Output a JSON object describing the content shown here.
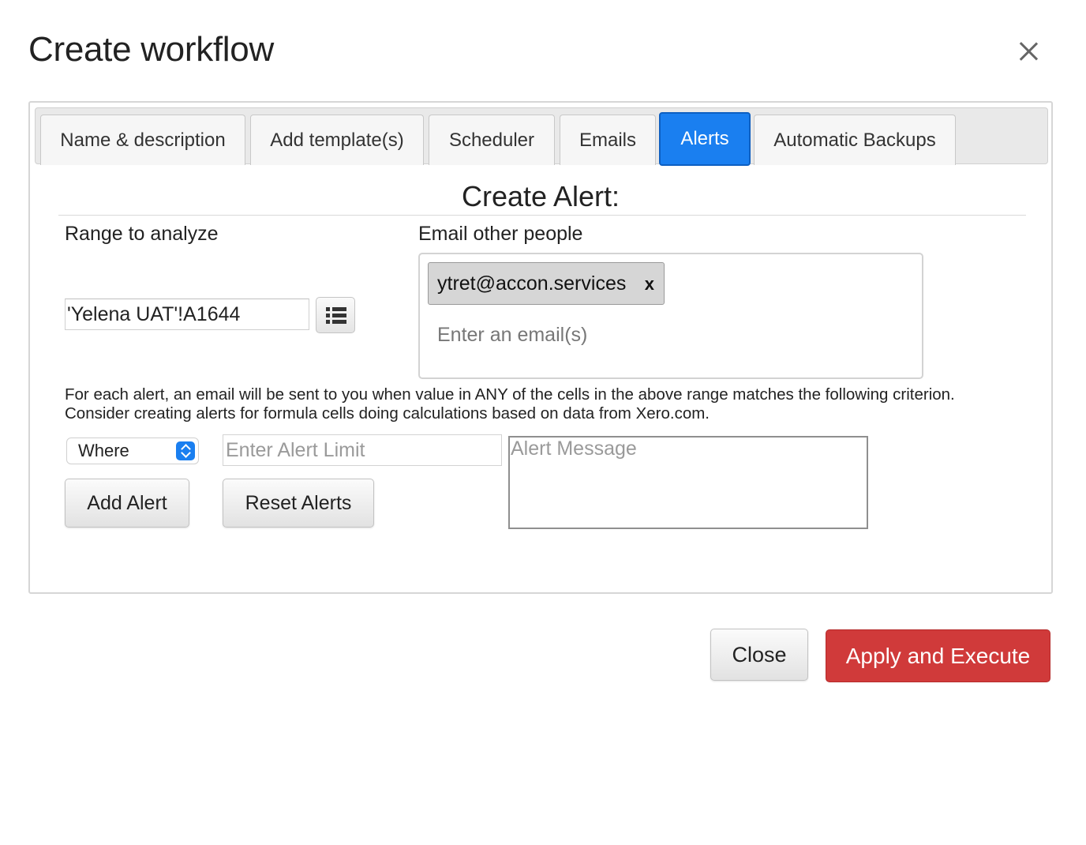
{
  "dialog": {
    "title": "Create workflow",
    "close_icon": "close-icon"
  },
  "tabs": [
    {
      "label": "Name & description",
      "active": false
    },
    {
      "label": "Add template(s)",
      "active": false
    },
    {
      "label": "Scheduler",
      "active": false
    },
    {
      "label": "Emails",
      "active": false
    },
    {
      "label": "Alerts",
      "active": true
    },
    {
      "label": "Automatic Backups",
      "active": false
    }
  ],
  "alert": {
    "section_title": "Create Alert:",
    "range_label": "Range to analyze",
    "range_value": "'Yelena UAT'!A1644",
    "range_picker_icon": "list-icon",
    "email_label": "Email other people",
    "email_chip": "ytret@accon.services",
    "email_chip_remove": "x",
    "email_placeholder": "Enter an email(s)",
    "description": "For each alert, an email will be sent to you when value in ANY of the cells in the above range matches the following criterion. Consider creating alerts for formula cells doing calculations based on data from Xero.com.",
    "condition_selected": "Where",
    "limit_placeholder": "Enter Alert Limit",
    "message_placeholder": "Alert Message",
    "add_button": "Add Alert",
    "reset_button": "Reset Alerts"
  },
  "footer": {
    "close_button": "Close",
    "apply_button": "Apply and Execute"
  },
  "colors": {
    "accent": "#1a7ff0",
    "danger": "#d03a3a"
  }
}
